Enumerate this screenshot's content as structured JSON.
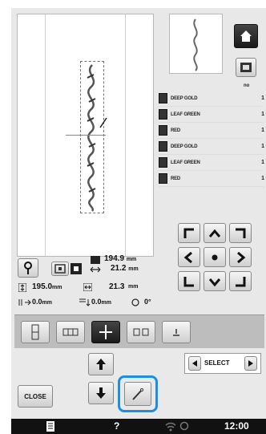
{
  "threads": {
    "count_header": "no",
    "items": [
      {
        "name": "DEEP GOLD",
        "count": "1"
      },
      {
        "name": "LEAF GREEN",
        "count": "1"
      },
      {
        "name": "RED",
        "count": "1"
      },
      {
        "name": "DEEP GOLD",
        "count": "1"
      },
      {
        "name": "LEAF GREEN",
        "count": "1"
      },
      {
        "name": "RED",
        "count": "1"
      }
    ]
  },
  "size": {
    "width_value": "194.9",
    "width_unit": "mm",
    "height_value": "21.2",
    "height_unit": "mm",
    "total_height": "195.0",
    "total_height_unit": "mm",
    "total_width": "21.3",
    "total_width_unit": "mm",
    "offset_x": "0.0",
    "offset_x_unit": "mm",
    "offset_y": "0.0",
    "offset_y_unit": "mm",
    "angle": "0°"
  },
  "select_label": "SELECT",
  "close_label": "CLOSE",
  "status": {
    "time": "12:00",
    "help": "?"
  },
  "colors": {
    "highlight": "#1e8fe0",
    "panel": "#e8e8e8",
    "status_bar": "#111111"
  }
}
